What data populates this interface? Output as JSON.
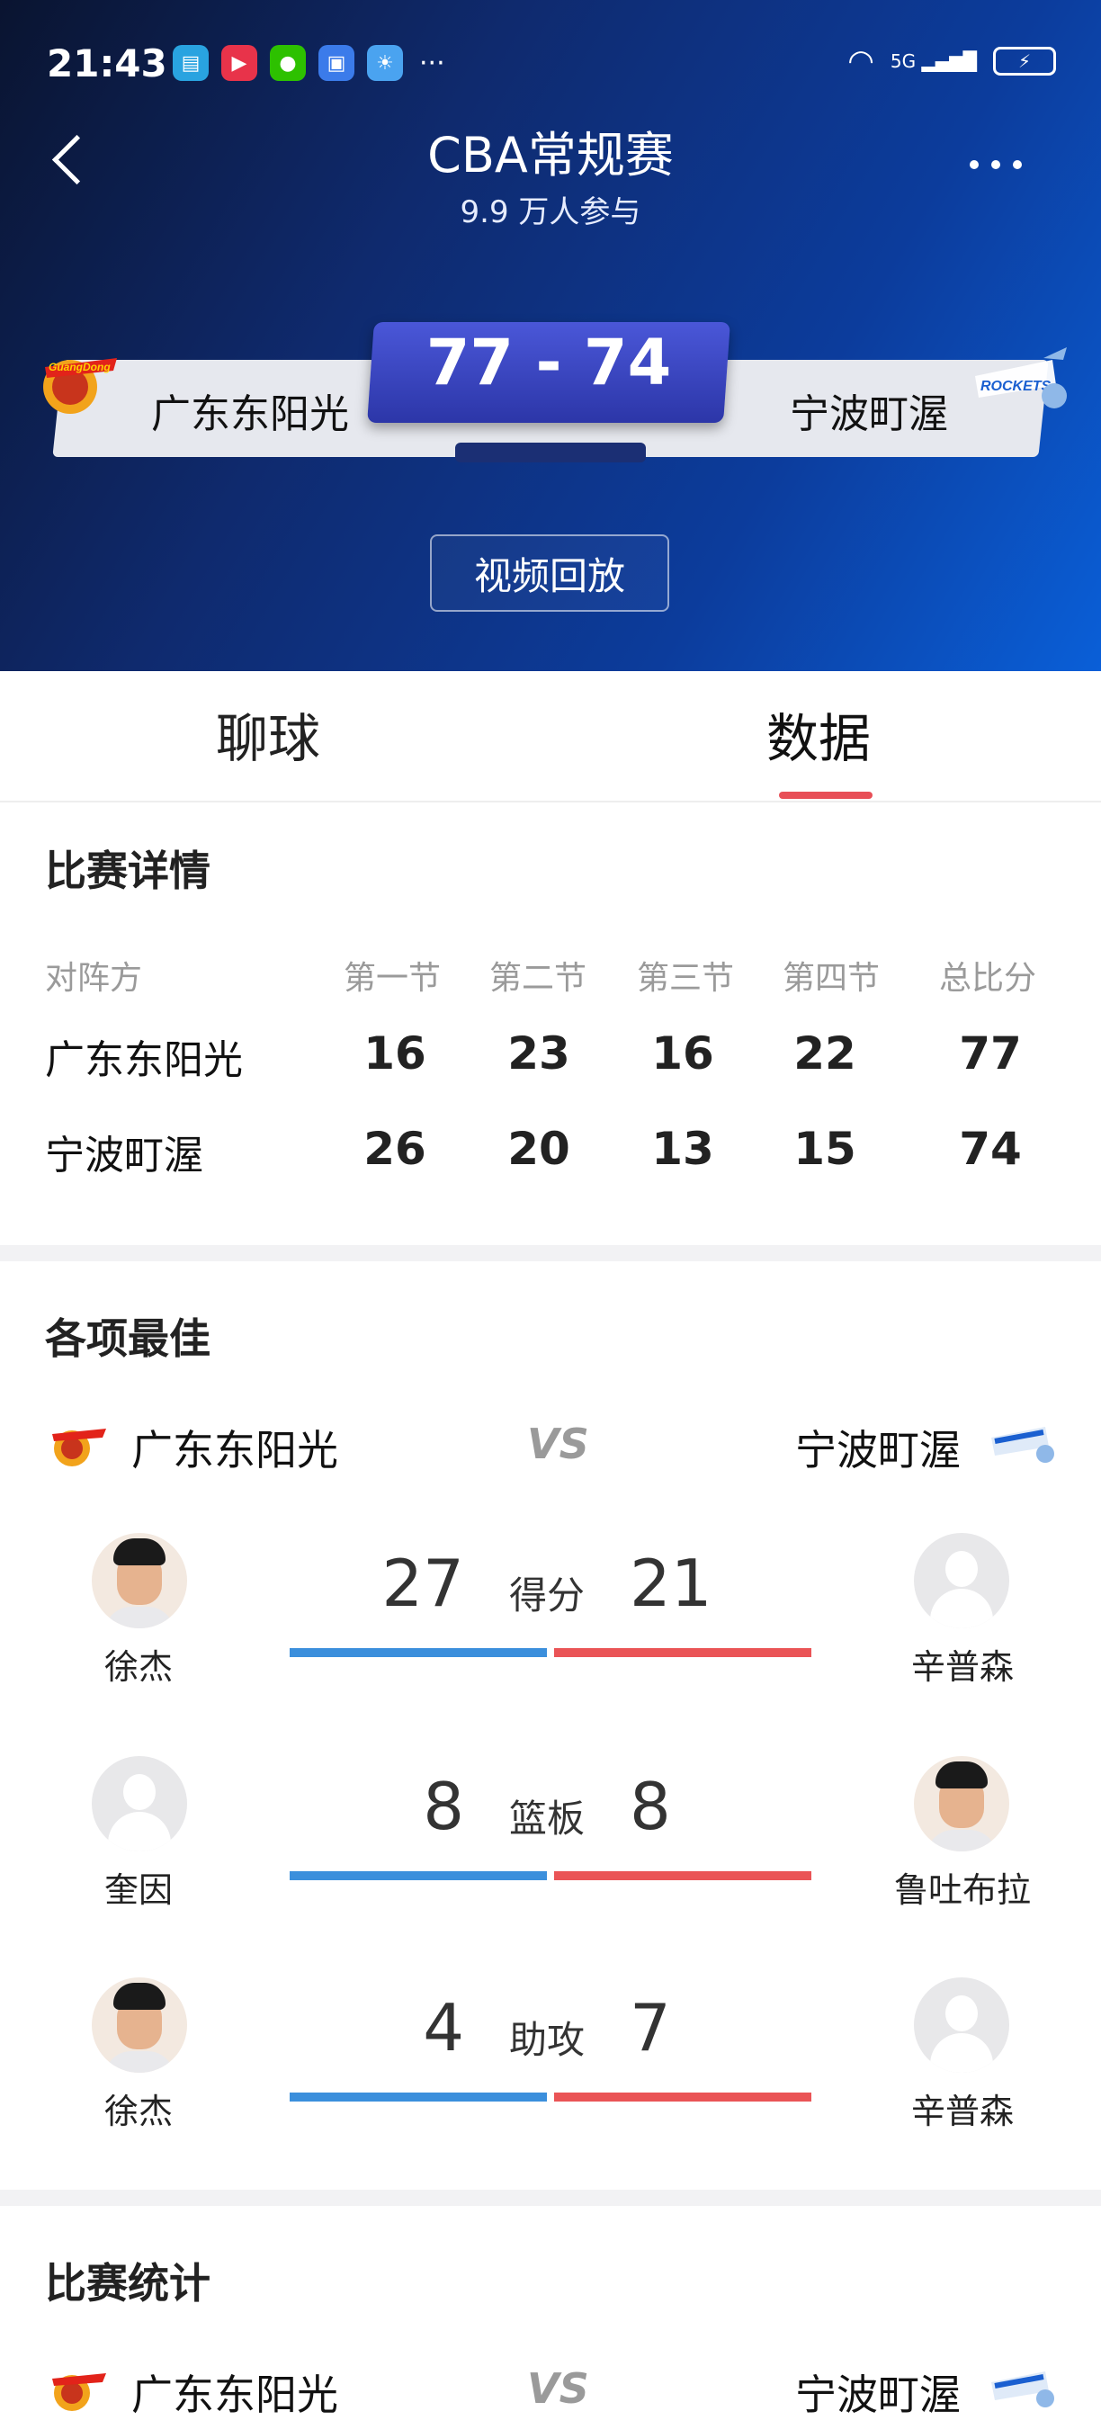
{
  "status_bar": {
    "time": "21:43",
    "more": "···",
    "network": "5G",
    "battery": "⚡"
  },
  "header": {
    "title": "CBA常规赛",
    "subtitle": "9.9 万人参与",
    "home_team": "广东东阳光",
    "away_team": "宁波町渥",
    "score": "77 - 74",
    "video_button": "视频回放"
  },
  "tabs": [
    {
      "label": "聊球",
      "active": false
    },
    {
      "label": "数据",
      "active": true
    }
  ],
  "match_detail": {
    "title": "比赛详情",
    "columns": [
      "对阵方",
      "第一节",
      "第二节",
      "第三节",
      "第四节",
      "总比分"
    ],
    "rows": [
      {
        "team": "广东东阳光",
        "scores": [
          "16",
          "23",
          "16",
          "22",
          "77"
        ]
      },
      {
        "team": "宁波町渥",
        "scores": [
          "26",
          "20",
          "13",
          "15",
          "74"
        ]
      }
    ]
  },
  "best": {
    "title": "各项最佳",
    "home_team": "广东东阳光",
    "away_team": "宁波町渥",
    "vs": "VS",
    "rows": [
      {
        "label": "得分",
        "home_player": "徐杰",
        "home_value": "27",
        "away_player": "辛普森",
        "away_value": "21"
      },
      {
        "label": "篮板",
        "home_player": "奎因",
        "home_value": "8",
        "away_player": "鲁吐布拉",
        "away_value": "8"
      },
      {
        "label": "助攻",
        "home_player": "徐杰",
        "home_value": "4",
        "away_player": "辛普森",
        "away_value": "7"
      }
    ]
  },
  "stats": {
    "title": "比赛统计",
    "home_team": "广东东阳光",
    "away_team": "宁波町渥",
    "vs": "VS"
  },
  "logos": {
    "home_text": "GuangDong",
    "away_text": "ROCKETS"
  },
  "colors": {
    "home_bar": "#3b8fdc",
    "away_bar": "#ea5456",
    "tab_indicator": "#e84f57",
    "score_box": "#3a45c2"
  }
}
